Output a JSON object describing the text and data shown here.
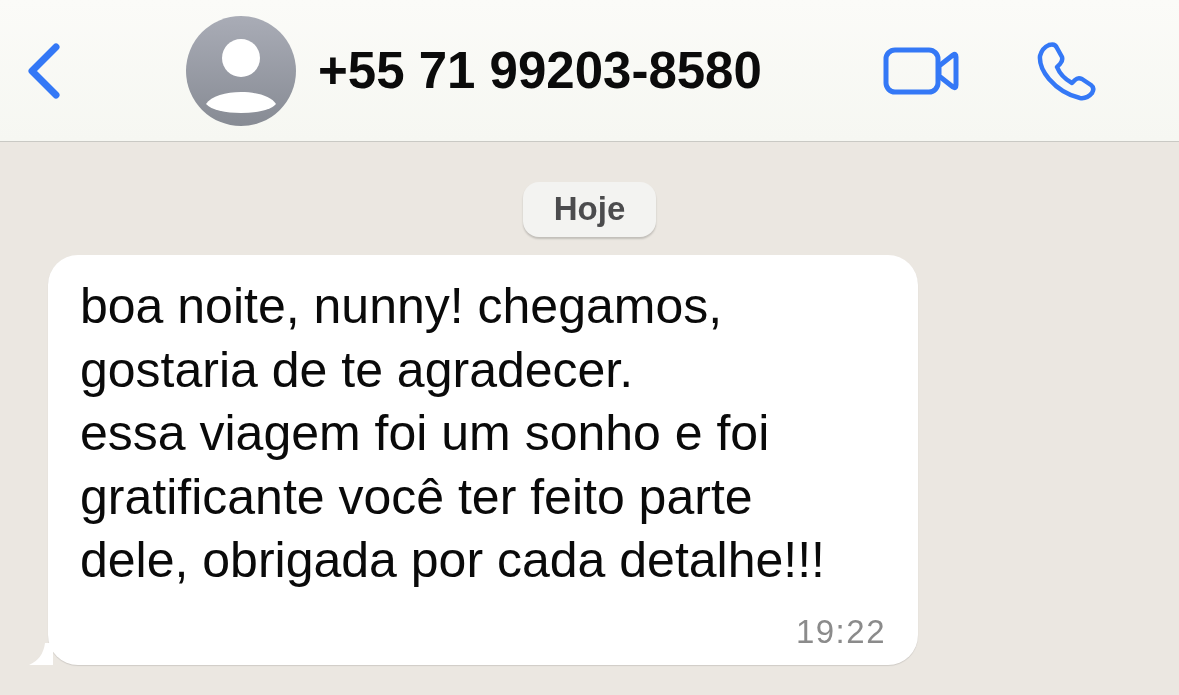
{
  "header": {
    "contact": "+55 71 99203-8580"
  },
  "date_chip": "Hoje",
  "messages": [
    {
      "text": "boa noite, nunny! chegamos, gostaria de te agradecer.\nessa viagem foi um sonho e foi gratificante você ter feito parte dele, obrigada por cada detalhe!!!",
      "time": "19:22"
    }
  ]
}
